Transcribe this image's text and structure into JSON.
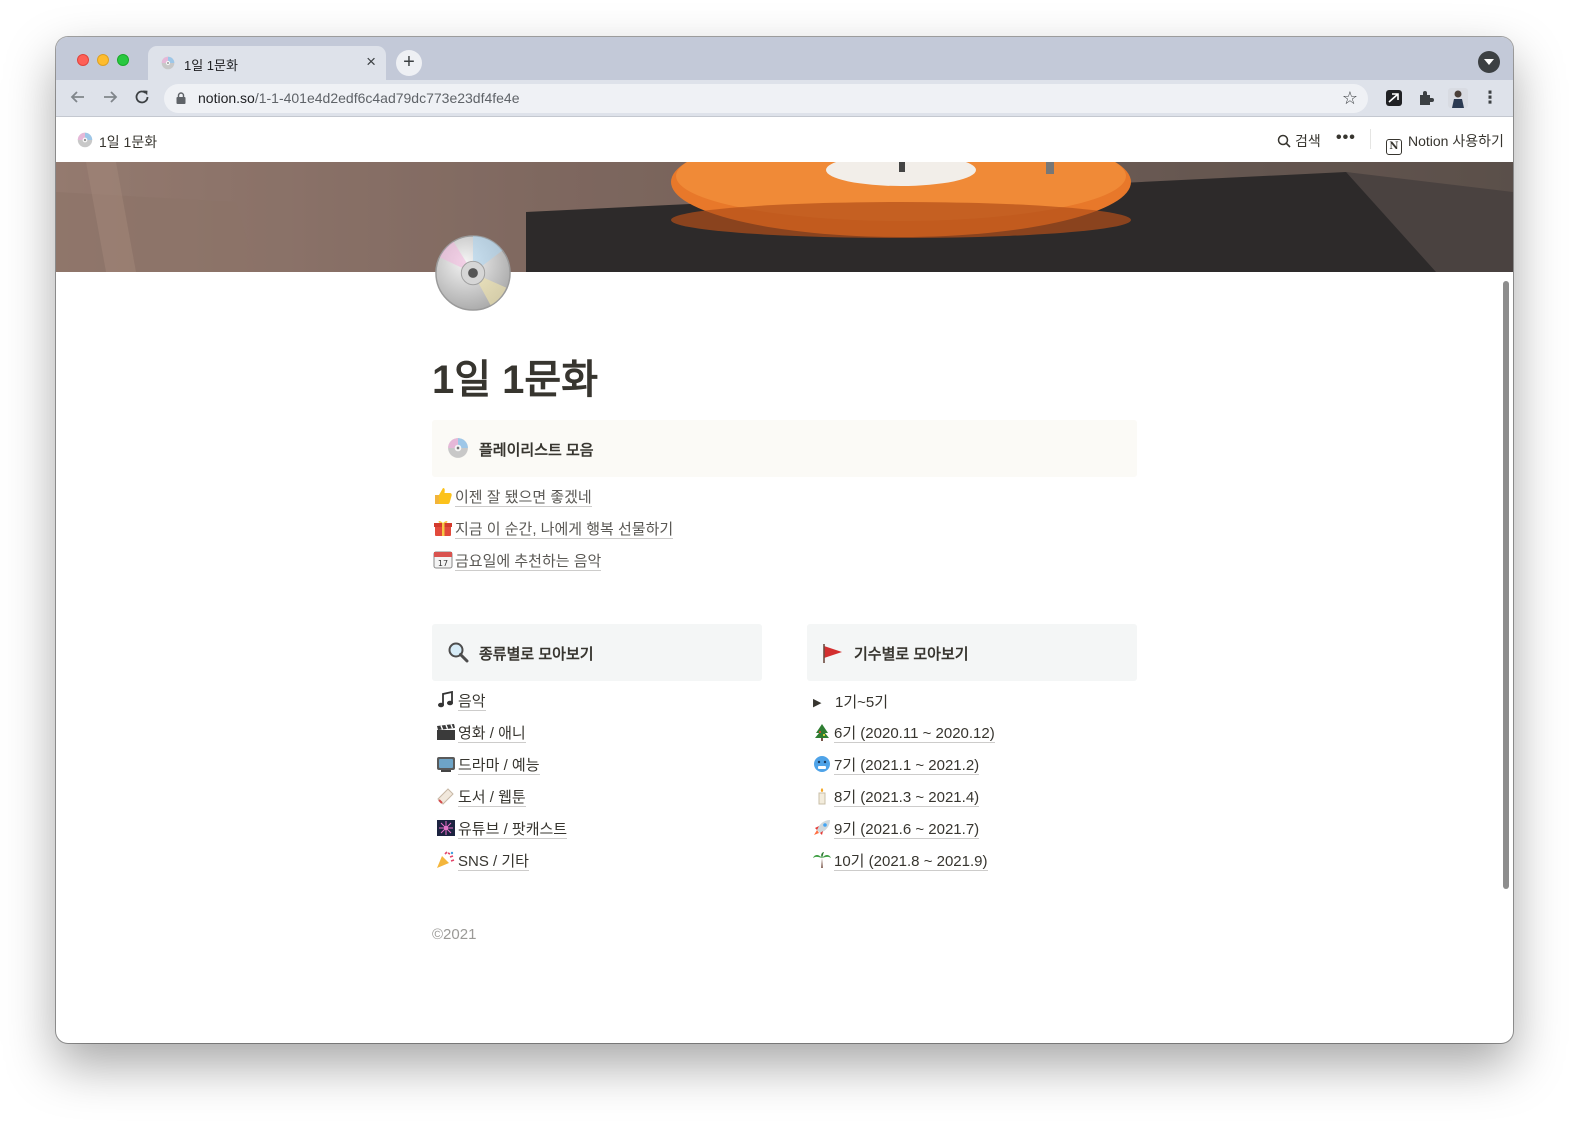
{
  "browser": {
    "tab_title": "1일 1문화",
    "tab_close": "×",
    "new_tab": "+",
    "url_host": "notion.so",
    "url_path": "/1-1-401e4d2edf6c4ad79dc773e23df4fe4e"
  },
  "notion_topbar": {
    "page_title": "1일 1문화",
    "search_label": "검색",
    "more_label": "•••",
    "notion_cta": "Notion 사용하기"
  },
  "page": {
    "title": "1일 1문화",
    "callout_playlist": "플레이리스트 모음",
    "playlist_links": [
      {
        "icon": "thumbs-up-icon",
        "label": "이젠 잘 됐으면 좋겠네"
      },
      {
        "icon": "gift-icon",
        "label": "지금 이 순간, 나에게 행복 선물하기"
      },
      {
        "icon": "calendar-icon",
        "label": "금요일에 추천하는 음악"
      }
    ],
    "callout_genre": "종류별로 모아보기",
    "callout_cohort": "기수별로 모아보기",
    "genre_links": [
      {
        "icon": "music-note-icon",
        "label": "음악"
      },
      {
        "icon": "clapper-board-icon",
        "label": "영화 / 애니"
      },
      {
        "icon": "television-icon",
        "label": "드라마 / 예능"
      },
      {
        "icon": "bookmark-icon",
        "label": "도서 / 웹툰"
      },
      {
        "icon": "fireworks-icon",
        "label": "유튜브 / 팟캐스트"
      },
      {
        "icon": "party-popper-icon",
        "label": "SNS / 기타"
      }
    ],
    "cohort_toggle": {
      "icon": "triangle-right-icon",
      "label": "1기~5기"
    },
    "cohort_links": [
      {
        "icon": "christmas-tree-icon",
        "label": "6기 (2020.11 ~ 2020.12)"
      },
      {
        "icon": "cold-face-icon",
        "label": "7기 (2021.1 ~ 2021.2)"
      },
      {
        "icon": "candle-icon",
        "label": "8기 (2021.3 ~ 2021.4)"
      },
      {
        "icon": "rocket-icon",
        "label": "9기 (2021.6 ~ 2021.7)"
      },
      {
        "icon": "palm-tree-icon",
        "label": "10기 (2021.8 ~ 2021.9)"
      }
    ],
    "footer": "©2021"
  },
  "colors": {
    "text": "#37352f",
    "tabstrip": "#c3c9d8",
    "toolbar": "#dee2ea",
    "callout_warm": "#fbfaf6",
    "callout_gray": "#f4f6f6"
  }
}
